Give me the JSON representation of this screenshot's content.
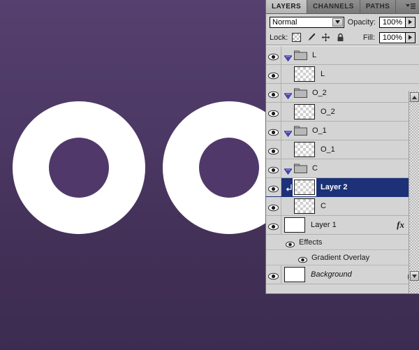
{
  "canvas": {
    "background_gradient_top": "#55406e",
    "background_gradient_bottom": "#3d2c51",
    "ring_color": "#ffffff",
    "ring_hole_color": "#50396a"
  },
  "panel": {
    "tabs": [
      {
        "label": "LAYERS",
        "active": true
      },
      {
        "label": "CHANNELS",
        "active": false
      },
      {
        "label": "PATHS",
        "active": false
      }
    ],
    "menu_icon": "panel-menu-icon",
    "blend_mode": "Normal",
    "opacity_label": "Opacity:",
    "opacity_value": "100%",
    "fill_label": "Fill:",
    "fill_value": "100%",
    "lock_label": "Lock:",
    "lock_icons": [
      "lock-transparent-pixels-icon",
      "lock-image-pixels-icon",
      "lock-position-icon",
      "lock-all-icon"
    ],
    "selection_color": "#1c3178",
    "panel_background": "#d4d4d4"
  },
  "layers": [
    {
      "name": "L",
      "type": "group",
      "visible": true,
      "expanded": true,
      "indent": 0
    },
    {
      "name": "L",
      "type": "layer",
      "visible": true,
      "indent": 1,
      "thumb": "transparent"
    },
    {
      "name": "O_2",
      "type": "group",
      "visible": true,
      "expanded": true,
      "indent": 0
    },
    {
      "name": "O_2",
      "type": "layer",
      "visible": true,
      "indent": 1,
      "thumb": "transparent"
    },
    {
      "name": "O_1",
      "type": "group",
      "visible": true,
      "expanded": true,
      "indent": 0
    },
    {
      "name": "O_1",
      "type": "layer",
      "visible": true,
      "indent": 1,
      "thumb": "transparent"
    },
    {
      "name": "C",
      "type": "group",
      "visible": true,
      "expanded": true,
      "indent": 0
    },
    {
      "name": "Layer 2",
      "type": "layer",
      "visible": true,
      "indent": 1,
      "thumb": "transparent",
      "selected": true,
      "clipped": true
    },
    {
      "name": "C",
      "type": "layer",
      "visible": true,
      "indent": 1,
      "thumb": "transparent"
    },
    {
      "name": "Layer 1",
      "type": "layer",
      "visible": true,
      "indent": 0,
      "thumb": "solid",
      "has_fx": true
    },
    {
      "name": "Background",
      "type": "layer",
      "visible": true,
      "indent": 0,
      "thumb": "solid",
      "locked": true,
      "italic": true
    }
  ],
  "effects": {
    "group_label": "Effects",
    "items": [
      "Gradient Overlay"
    ]
  },
  "scrollbar": {
    "up_icon": "scroll-up-arrow-icon",
    "down_icon": "scroll-down-arrow-icon"
  }
}
